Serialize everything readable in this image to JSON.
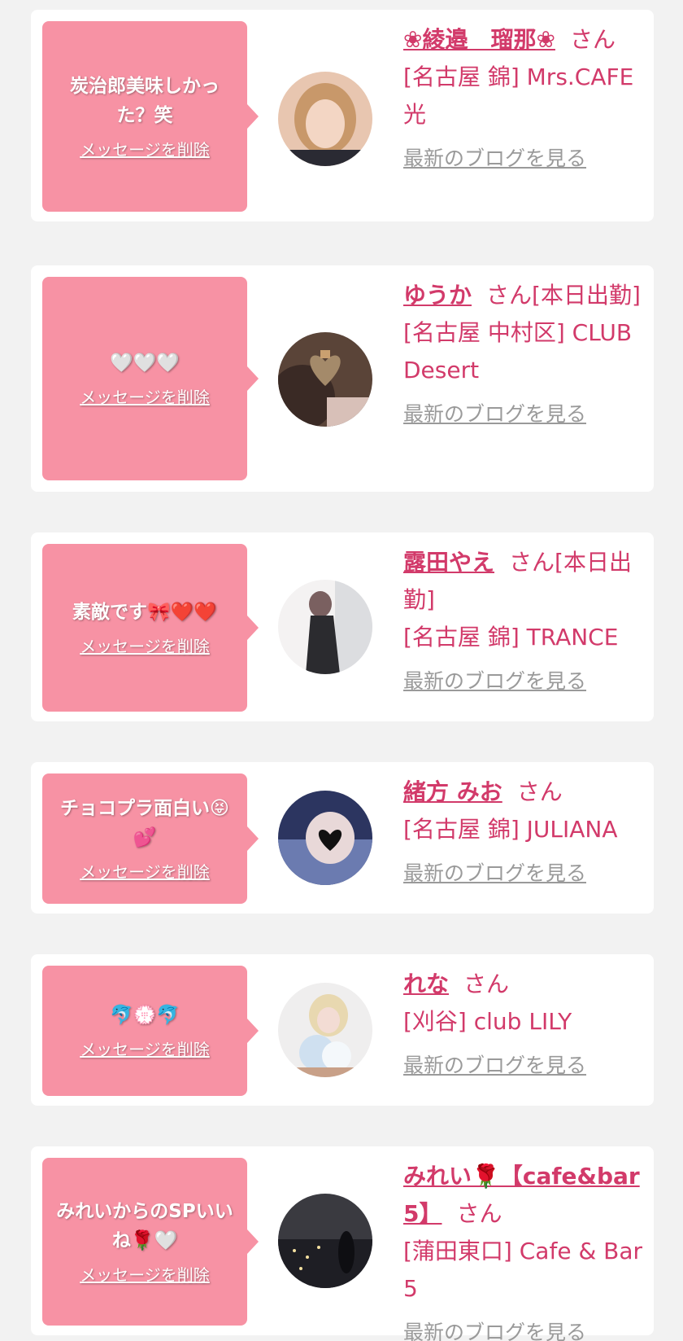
{
  "san_label": "さん",
  "delete_label": "メッセージを削除",
  "blog_label": "最新のブログを見る",
  "colors": {
    "background": "#f2f2f2",
    "card": "#ffffff",
    "bubble": "#f792a4",
    "accent_text": "#d23a6a",
    "link_gray": "#9a9a9a"
  },
  "items": [
    {
      "message": "炭治郎美味しかった？笑",
      "name": "❀綾邉　瑠那❀",
      "name_suffix": "",
      "shop": "[名古屋 錦] Mrs.CAFE 光",
      "avatar_icon": "avatar-blonde-woman"
    },
    {
      "message": "🤍🤍🤍",
      "name": "ゆうか",
      "name_suffix": "[本日出勤]",
      "shop": "[名古屋 中村区] CLUB Desert",
      "avatar_icon": "avatar-heart-bow"
    },
    {
      "message": "素敵です🎀❤️❤️",
      "name": "露田やえ",
      "name_suffix": "[本日出勤]",
      "shop": "[名古屋 錦] TRANCE",
      "avatar_icon": "avatar-woman-dress"
    },
    {
      "message": "チョコプラ面白い😝💕",
      "name": "緒方 みお",
      "name_suffix": "",
      "shop": "[名古屋 錦] JULIANA",
      "avatar_icon": "avatar-heart-face"
    },
    {
      "message": "🐬💮🐬",
      "name": "れな",
      "name_suffix": "",
      "shop": "[刈谷] club LILY",
      "avatar_icon": "avatar-bouquet"
    },
    {
      "message": "みれいからのSPいいね🌹🤍",
      "name": "みれい🌹【cafe&bar 5】",
      "name_suffix": "",
      "shop": "[蒲田東口] Cafe & Bar 5",
      "avatar_icon": "avatar-night-view"
    }
  ]
}
